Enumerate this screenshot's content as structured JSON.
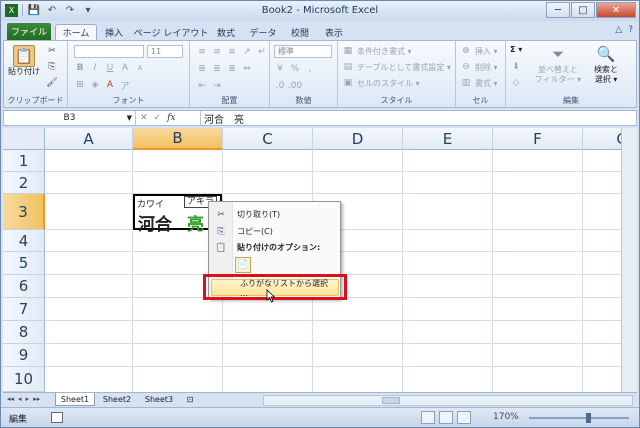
{
  "window": {
    "title": "Book2 - Microsoft Excel",
    "minimize": "─",
    "maximize": "□",
    "close": "✕"
  },
  "qat": {
    "save": "💾",
    "undo": "↶",
    "redo": "↷",
    "more": "▾"
  },
  "tabs": {
    "file": "ファイル",
    "items": [
      "ホーム",
      "挿入",
      "ページ レイアウト",
      "数式",
      "データ",
      "校閲",
      "表示"
    ],
    "help": "?",
    "ribbon_min": "△"
  },
  "ribbon": {
    "clipboard": {
      "paste_label": "貼り付け",
      "group_label": "クリップボード"
    },
    "font": {
      "font_name": "",
      "font_size": "11",
      "bold": "B",
      "italic": "I",
      "underline": "U",
      "grow": "A",
      "shrink": "A",
      "group_label": "フォント"
    },
    "alignment": {
      "group_label": "配置"
    },
    "number": {
      "format": "標準",
      "group_label": "数値"
    },
    "styles": {
      "conditional": "条件付き書式 ▾",
      "table": "テーブルとして書式設定 ▾",
      "cell_styles": "セルのスタイル ▾",
      "group_label": "スタイル"
    },
    "cells": {
      "insert": "挿入 ▾",
      "delete": "削除 ▾",
      "format": "書式 ▾",
      "group_label": "セル"
    },
    "editing": {
      "sum": "Σ ▾",
      "sort_filter": "並べ替えと\nフィルター ▾",
      "find_select": "検索と\n選択 ▾",
      "group_label": "編集"
    }
  },
  "formula_bar": {
    "name_box": "B3",
    "fx": "fx",
    "cancel": "✕",
    "enter": "✓",
    "content": "河合　亮"
  },
  "grid": {
    "columns": [
      "A",
      "B",
      "C",
      "D",
      "E",
      "F",
      "G"
    ],
    "rows": [
      "1",
      "2",
      "3",
      "4",
      "5",
      "6",
      "7",
      "8",
      "9",
      "10"
    ],
    "selected_col": "B",
    "selected_row": "3"
  },
  "cell_b3": {
    "furigana_1": "カワイ",
    "furigana_2": "アキラ",
    "text_1": "河合",
    "text_2": "亮"
  },
  "context_menu": {
    "cut": "切り取り(T)",
    "copy": "コピー(C)",
    "paste_options": "貼り付けのオプション:",
    "furigana_select": "ふりがなリストから選択 ..."
  },
  "sheets": {
    "nav": [
      "◂◂",
      "◂",
      "▸",
      "▸▸"
    ],
    "tabs": [
      "Sheet1",
      "Sheet2",
      "Sheet3"
    ],
    "active": "Sheet1"
  },
  "status": {
    "mode": "編集",
    "zoom": "170%",
    "zoom_level_percent": 170
  }
}
